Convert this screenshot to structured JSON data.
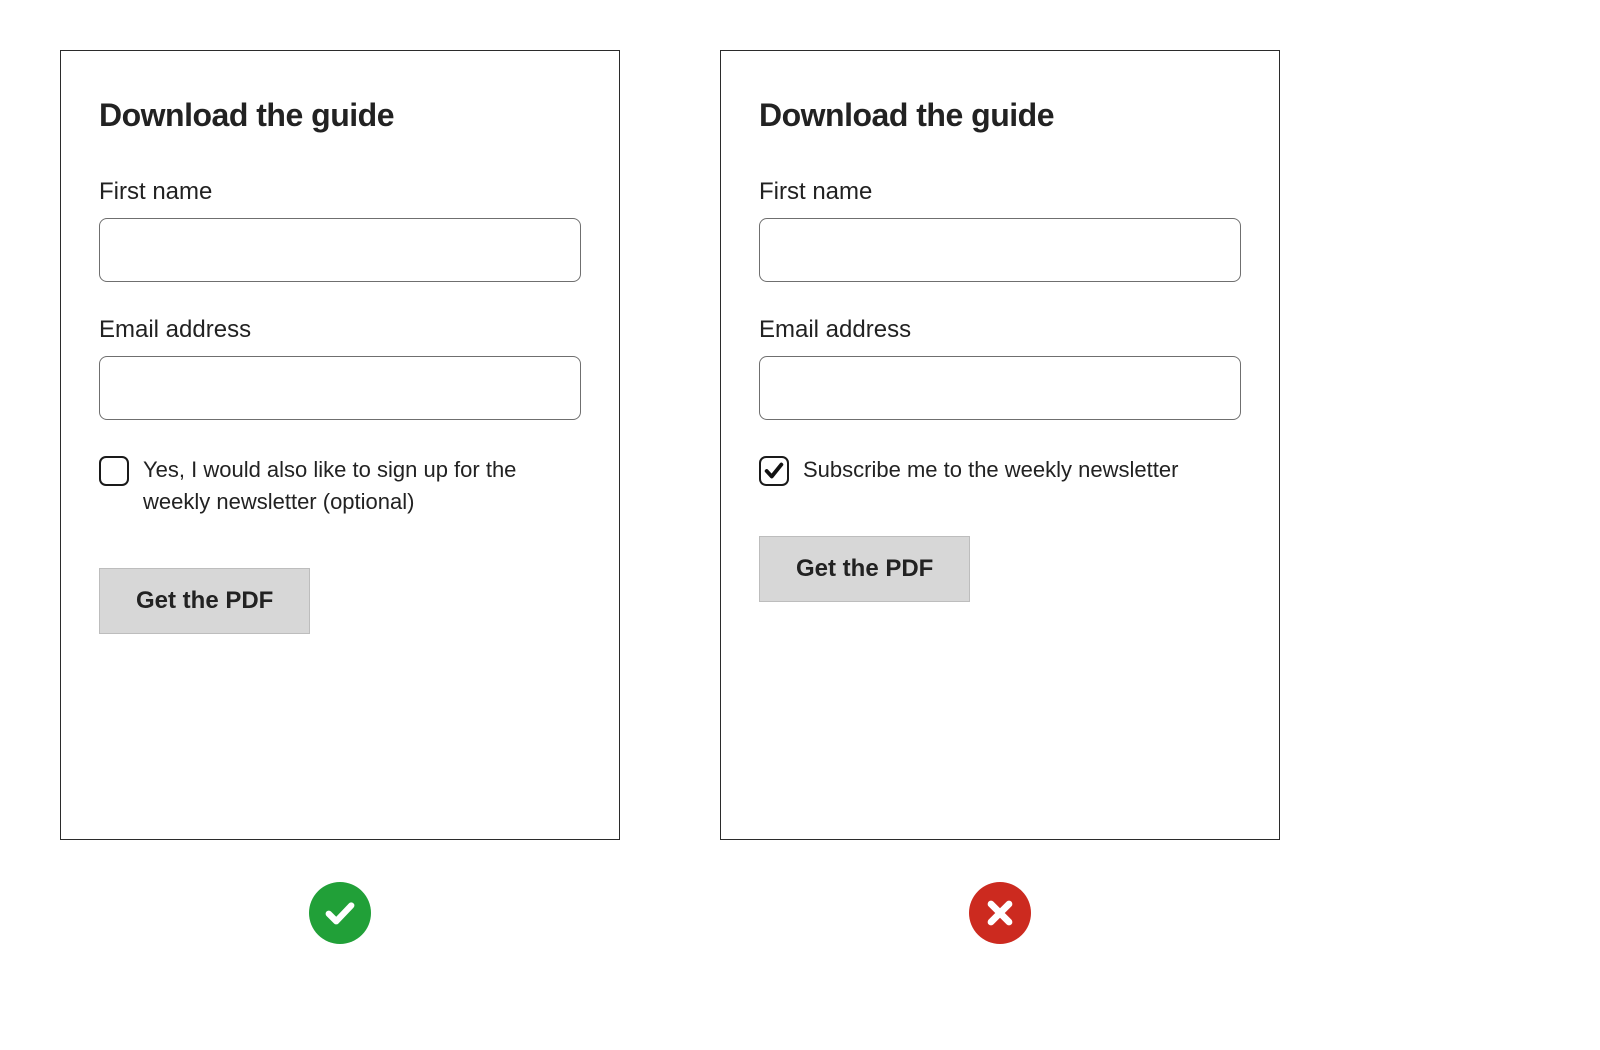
{
  "good": {
    "title": "Download the guide",
    "first_name_label": "First name",
    "first_name_value": "",
    "email_label": "Email address",
    "email_value": "",
    "checkbox_checked": false,
    "checkbox_label": "Yes, I would also like to sign up for the weekly newsletter (optional)",
    "button_label": "Get the PDF",
    "verdict": "good"
  },
  "bad": {
    "title": "Download the guide",
    "first_name_label": "First name",
    "first_name_value": "",
    "email_label": "Email address",
    "email_value": "",
    "checkbox_checked": true,
    "checkbox_label": "Subscribe me to the weekly newsletter",
    "button_label": "Get the PDF",
    "verdict": "bad"
  },
  "colors": {
    "good_badge": "#21a038",
    "bad_badge": "#cc2a1f",
    "button_bg": "#d7d7d7",
    "card_border": "#2b2b2b"
  }
}
